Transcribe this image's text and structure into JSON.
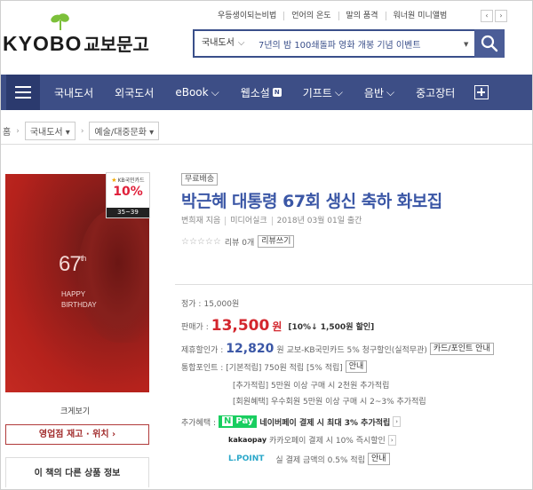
{
  "header": {
    "top_links": [
      "우등생이되는비법",
      "언어의 온도",
      "말의 품격",
      "워너원 미니앨범"
    ],
    "arrow_prev": "‹",
    "arrow_next": "›",
    "logo_text": "KYOBO",
    "logo_kor": "교보문고",
    "search": {
      "category": "국내도서",
      "category_chevron": "⌵",
      "value": "7년의 밤 100쇄돌파 영화 개봉 기념 이벤트",
      "dropdown_icon": "▼",
      "search_icon": "search-icon"
    }
  },
  "nav": {
    "items": [
      {
        "label": "국내도서",
        "chevron": ""
      },
      {
        "label": "외국도서",
        "chevron": ""
      },
      {
        "label": "eBook",
        "chevron": "⌵"
      },
      {
        "label": "웹소설",
        "badge": "N"
      },
      {
        "label": "기프트",
        "chevron": "⌵"
      },
      {
        "label": "음반",
        "chevron": "⌵"
      },
      {
        "label": "중고장터",
        "chevron": ""
      }
    ]
  },
  "breadcrumb": {
    "home": "홈",
    "sep": "›",
    "items": [
      "국내도서 ▾",
      "예술/대중문화 ▾"
    ]
  },
  "cover": {
    "number": "67",
    "suffix": "th",
    "line1": "HAPPY",
    "line2": "BIRTHDAY",
    "kb_label": "KB국민카드",
    "kb_discount": "10%",
    "kb_age": "35~39"
  },
  "left_panel": {
    "zoom": "크게보기",
    "store_button": "영업점 재고 · 위치  ›",
    "other_info": "이 책의 다른 상품 정보"
  },
  "product": {
    "free_shipping": "무료배송",
    "title": "박근혜 대통령 67회 생신 축하 화보집",
    "author": "변희재 지음",
    "publisher": "미디어실크",
    "date": "2018년 03월 01일 출간",
    "stars": "☆☆☆☆☆",
    "review_count": "리뷰 0개",
    "review_button": "리뷰쓰기",
    "list_price_label": "정가 :",
    "list_price": "15,000원",
    "sale_label": "판매가 :",
    "sale_price": "13,500",
    "sale_unit": "원",
    "sale_discount": "[10%↓ 1,500원 할인]",
    "partner_label": "제휴할인가 :",
    "partner_price": "12,820",
    "partner_unit": "원",
    "partner_desc": "교보-KB국민카드 5% 청구할인(실적무관)",
    "card_btn": "카드/포인트 안내",
    "point_label": "통합포인트 :",
    "point_basic": "[기본적립] 750원 적립 [5% 적립]",
    "point_btn": "안내",
    "point_extra": "[추가적립] 5만원 이상 구매 시 2천원 추가적립",
    "point_member": "[회원혜택] 우수회원 5만원 이상 구매 시 2~3% 추가적립",
    "benefit_label": "추가혜택 :",
    "npay_n": "N",
    "npay_text": "Pay",
    "npay_desc": "네이버페이 결제 시 최대 3% 추가적립",
    "kakao_logo": "kakaopay",
    "kakao_desc": "카카오페이 결제 시 10% 즉시할인",
    "lpoint_logo": "L.POINT",
    "lpoint_desc": "실 결제 금액의 0.5% 적립",
    "lpoint_btn": "안내",
    "arrow": "›"
  }
}
